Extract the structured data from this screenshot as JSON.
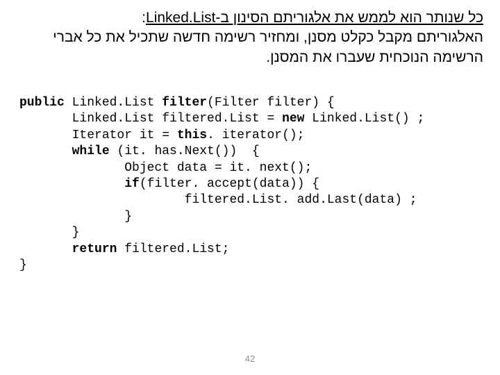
{
  "hebrew": {
    "title_prefix": "כל שנותר הוא לממש את אלגוריתם הסינון ב-",
    "title_suffix": "Linked.List",
    "title_colon": ":",
    "line2": "האלגוריתם מקבל כקלט מסנן, ומחזיר רשימה חדשה שתכיל את כל אברי",
    "line3": "הרשימה הנוכחית שעברו את המסנן."
  },
  "code": {
    "kw_public": "public",
    "t_ll1": " Linked.List ",
    "fn_filter": "filter",
    "sig_rest": "(Filter filter) {",
    "l2a": "       Linked.List filtered.List = ",
    "kw_new": "new",
    "l2b": " Linked.List() ;",
    "l3": "       Iterator it = ",
    "kw_this": "this",
    "l3b": ". iterator();",
    "l4a": "       ",
    "kw_while": "while",
    "l4b": " (it. has.Next())  {",
    "l5": "              Object data = it. next();",
    "l6a": "              ",
    "kw_if": "if",
    "l6b": "(filter. accept(data)) {",
    "l7": "                      filtered.List. add.Last(data) ;",
    "l8": "              }",
    "l9": "       }",
    "l10a": "       ",
    "kw_return": "return",
    "l10b": " filtered.List;",
    "l11": "}"
  },
  "page_number": "42"
}
